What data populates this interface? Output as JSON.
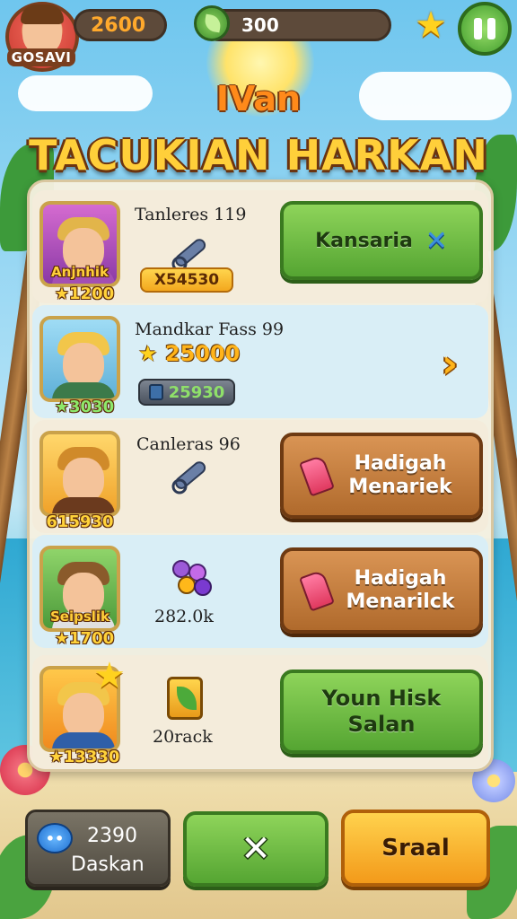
{
  "top_bar": {
    "player_name": "GOSAVI",
    "coins": "2600",
    "leaves": "300"
  },
  "header": {
    "subtitle": "IVan",
    "title": "TACUKIAN HARKAN"
  },
  "rows": [
    {
      "label": "Tanleres 119",
      "portrait_name": "Anjnhik",
      "portrait_score": "1200",
      "value": "X54530",
      "icon": "link-icon",
      "action_label": "Kansaria",
      "action_style": "green"
    },
    {
      "label": "Mandkar Fass 99",
      "portrait_score": "3030",
      "value_star": "25000",
      "value_box": "25930",
      "action_style": "chevron"
    },
    {
      "label": "Canleras 96",
      "portrait_score": "615930",
      "icon": "link-icon",
      "action_label": "Hadigah Menariek",
      "action_style": "wood"
    },
    {
      "portrait_name": "Seipslik",
      "portrait_score": "1700",
      "value": "282.0k",
      "icon": "grapes-icon",
      "action_label": "Hadigah Menarilck",
      "action_style": "wood"
    },
    {
      "portrait_score": "13330",
      "value": "20rack",
      "icon": "jar-icon",
      "action_label": "Youn Hisk Salan",
      "action_style": "green"
    }
  ],
  "bottom": {
    "chat_count": "2390",
    "chat_label": "Daskan",
    "close_label": "✕",
    "right_label": "Sraal"
  },
  "colors": {
    "accent_orange": "#ff8a1a",
    "title_yellow": "#ffcf3a",
    "button_green": "#55a532",
    "button_wood": "#b06a2c"
  }
}
